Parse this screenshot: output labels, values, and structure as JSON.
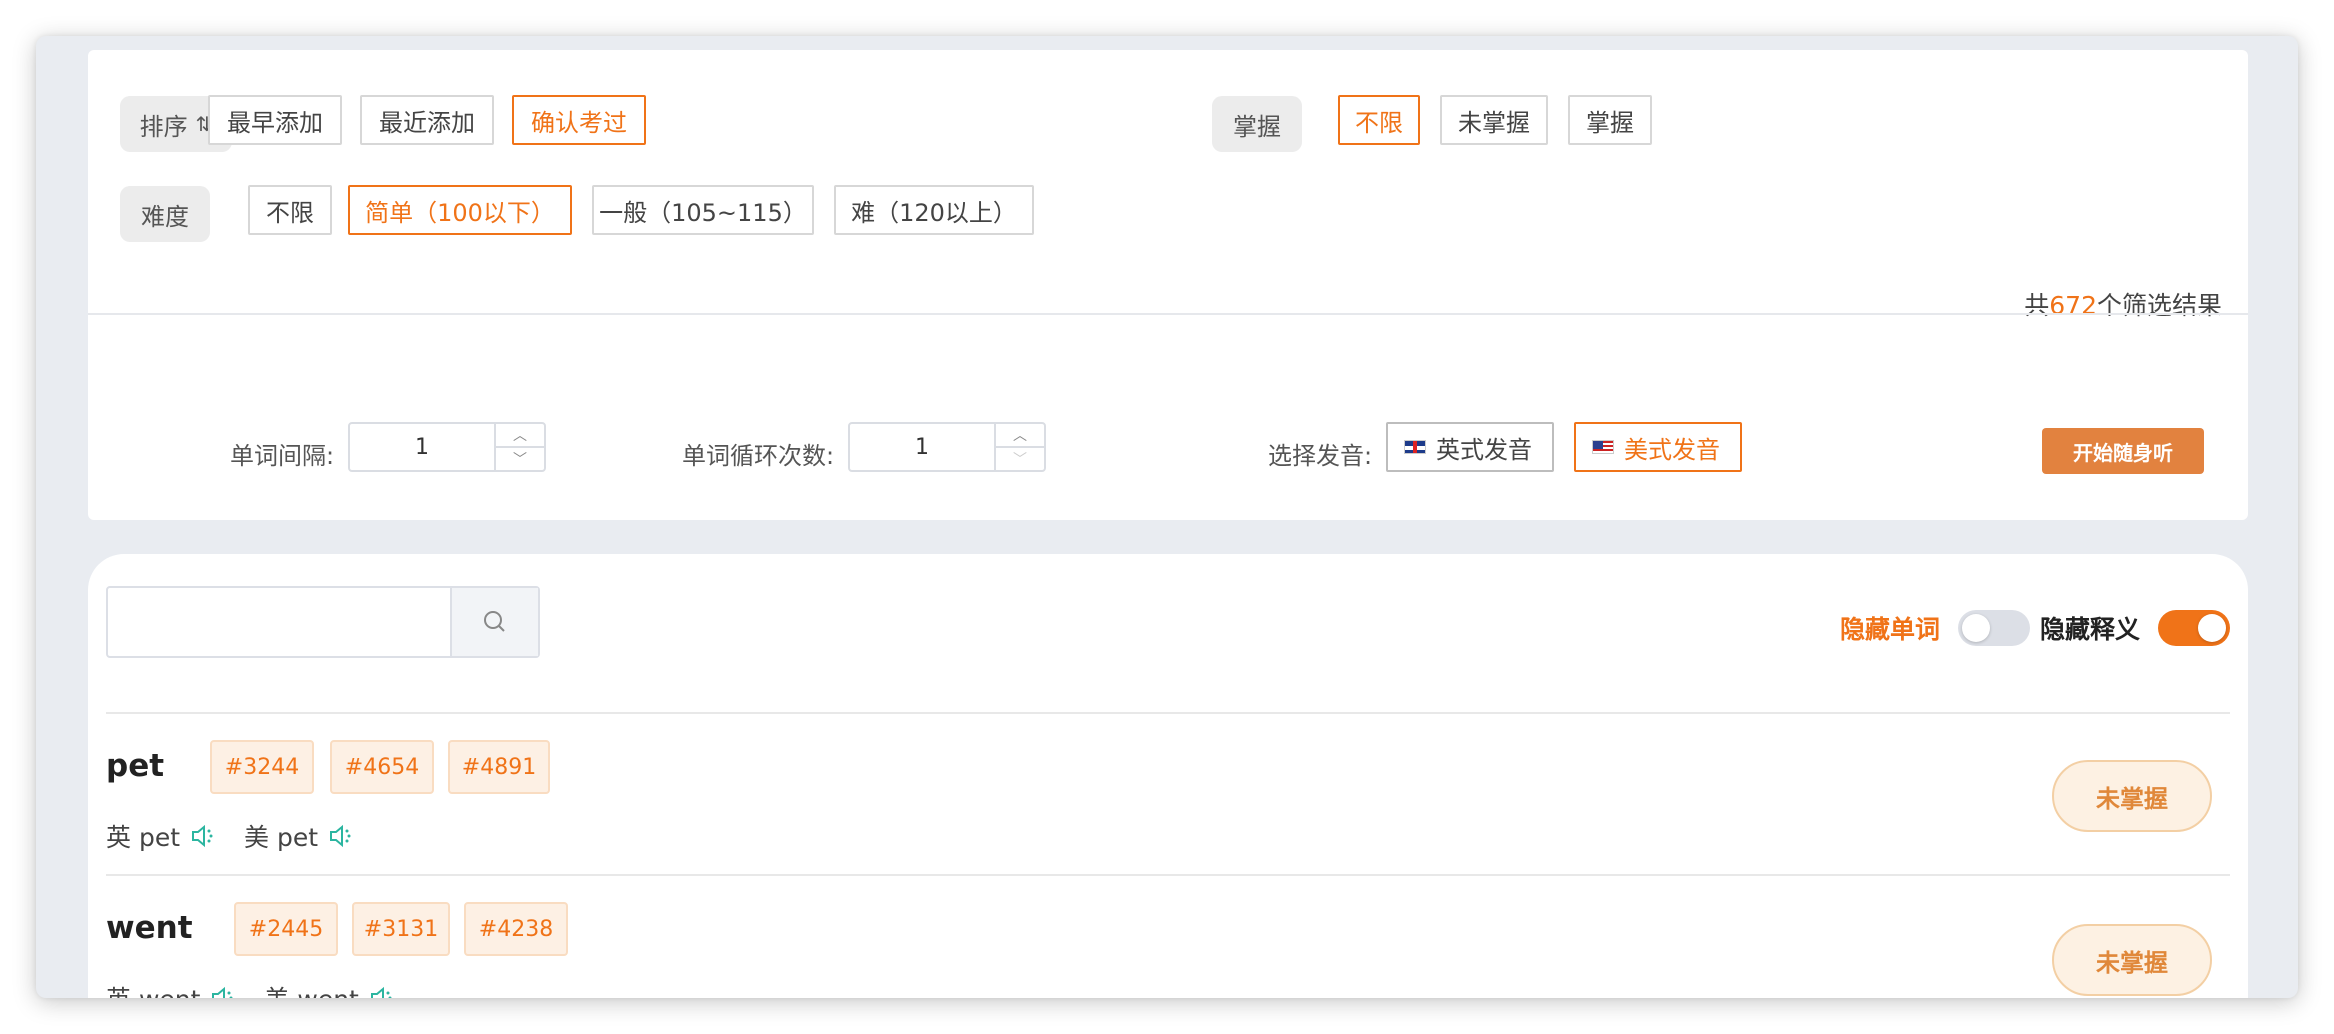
{
  "filters": {
    "sort": {
      "label": "排序",
      "options": [
        "最早添加",
        "最近添加",
        "确认考过"
      ],
      "selected": "确认考过"
    },
    "mastery": {
      "label": "掌握",
      "options": [
        "不限",
        "未掌握",
        "掌握"
      ],
      "selected": "不限"
    },
    "difficulty": {
      "label": "难度",
      "options": [
        "不限",
        "简单（100以下）",
        "一般（105~115）",
        "难（120以上）"
      ],
      "selected": "简单（100以下）"
    },
    "result": {
      "prefix": "共",
      "count": "672",
      "suffix": "个筛选结果"
    }
  },
  "playback": {
    "interval_label": "单词间隔:",
    "interval_value": "1",
    "loop_label": "单词循环次数:",
    "loop_value": "1",
    "voice_label": "选择发音:",
    "voices": [
      "英式发音",
      "美式发音"
    ],
    "selected_voice": "美式发音",
    "start_label": "开始随身听"
  },
  "list": {
    "search_placeholder": "",
    "hide_word_label": "隐藏单词",
    "hide_word_on": false,
    "hide_meaning_label": "隐藏释义",
    "hide_meaning_on": true,
    "words": [
      {
        "word": "pet",
        "tags": [
          "#3244",
          "#4654",
          "#4891"
        ],
        "uk_label": "英 pet",
        "us_label": "美 pet",
        "status": "未掌握"
      },
      {
        "word": "went",
        "tags": [
          "#2445",
          "#3131",
          "#4238"
        ],
        "uk_label": "英 went",
        "us_label": "美 went",
        "status": "未掌握"
      }
    ]
  },
  "colors": {
    "accent": "#f07318",
    "start_button": "#e2823f",
    "speaker": "#2bb5a0"
  }
}
